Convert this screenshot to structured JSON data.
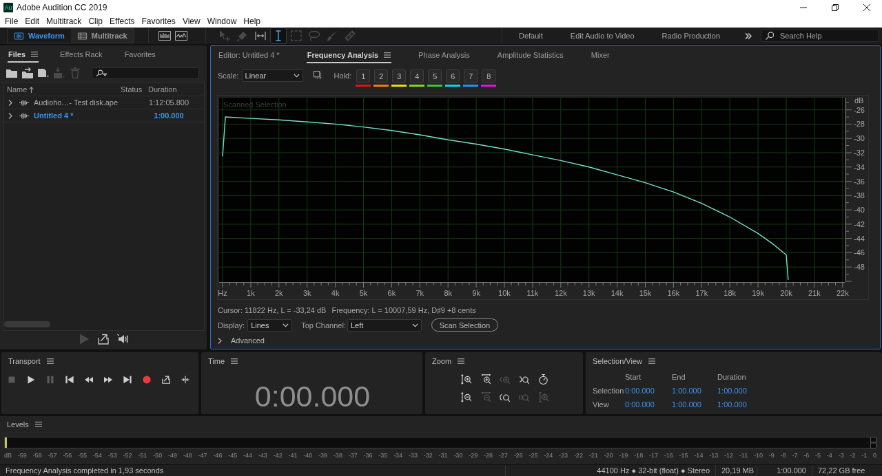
{
  "window": {
    "app_icon": "Au",
    "title": "Adobe Audition CC 2019"
  },
  "menu": [
    "File",
    "Edit",
    "Multitrack",
    "Clip",
    "Effects",
    "Favorites",
    "View",
    "Window",
    "Help"
  ],
  "toolbar": {
    "modes": [
      {
        "label": "Waveform",
        "kind": "waveform",
        "selected": true
      },
      {
        "label": "Multitrack",
        "kind": "multitrack",
        "selected": false
      }
    ],
    "tools": [
      {
        "kind": "move",
        "selected": false,
        "disabled": true
      },
      {
        "kind": "razor",
        "selected": false,
        "disabled": true
      },
      {
        "kind": "slip",
        "selected": false,
        "disabled": false
      },
      {
        "kind": "time",
        "selected": true,
        "disabled": false
      },
      {
        "kind": "marquee",
        "selected": false,
        "disabled": true
      },
      {
        "kind": "lasso",
        "selected": false,
        "disabled": true
      },
      {
        "kind": "brush",
        "selected": false,
        "disabled": true
      },
      {
        "kind": "heal",
        "selected": false,
        "disabled": true
      }
    ],
    "workspaces": [
      "Default",
      "Edit Audio to Video",
      "Radio Production"
    ],
    "search": {
      "placeholder": "Search Help"
    }
  },
  "files_panel": {
    "tabs": [
      {
        "label": "Files",
        "selected": true
      },
      {
        "label": "Effects Rack",
        "selected": false
      },
      {
        "label": "Favorites",
        "selected": false
      }
    ],
    "tools": [
      {
        "kind": "open",
        "disabled": false
      },
      {
        "kind": "import",
        "disabled": false
      },
      {
        "kind": "new",
        "disabled": false
      },
      {
        "kind": "insert",
        "disabled": true
      },
      {
        "kind": "delete",
        "disabled": true
      }
    ],
    "columns": [
      "Name",
      "Status",
      "Duration"
    ],
    "rows": [
      {
        "name": "Audioho…- Test disk.ape",
        "duration": "1:12:05.800",
        "selected": false,
        "expanded": false
      },
      {
        "name": "Untitled 4 *",
        "duration": "1:00.000",
        "selected": true,
        "expanded": false
      }
    ],
    "footer_tools": [
      {
        "kind": "play",
        "disabled": true
      },
      {
        "kind": "export",
        "disabled": false
      },
      {
        "kind": "autoplay",
        "disabled": false
      }
    ]
  },
  "editor": {
    "tabs": [
      {
        "label": "Editor: Untitled 4 *",
        "selected": false
      },
      {
        "label": "Frequency Analysis",
        "selected": true
      },
      {
        "label": "Phase Analysis",
        "selected": false
      },
      {
        "label": "Amplitude Statistics",
        "selected": false
      },
      {
        "label": "Mixer",
        "selected": false
      }
    ],
    "scale": {
      "label": "Scale:",
      "value": "Linear"
    },
    "hold": {
      "label": "Hold:",
      "buttons": [
        {
          "label": "1",
          "color": "#e01414"
        },
        {
          "label": "2",
          "color": "#f07c14"
        },
        {
          "label": "3",
          "color": "#e8e014"
        },
        {
          "label": "4",
          "color": "#84d824"
        },
        {
          "label": "5",
          "color": "#38c838"
        },
        {
          "label": "6",
          "color": "#14d0e8"
        },
        {
          "label": "7",
          "color": "#2c90e8"
        },
        {
          "label": "8",
          "color": "#e014e0"
        }
      ]
    },
    "plot_caption": "Scanned Selection",
    "chart_data": {
      "type": "line",
      "grid": true,
      "xlabel": "Hz",
      "ylabel": "dB",
      "x": [
        0,
        100,
        1000,
        2000,
        3000,
        4000,
        5000,
        6000,
        7000,
        8000,
        9000,
        10000,
        11000,
        12000,
        13000,
        14000,
        15000,
        16000,
        17000,
        18000,
        19000,
        19500,
        20000,
        20070
      ],
      "series": [
        {
          "color": "#72e2c6",
          "values": [
            -32.5,
            -27.0,
            -27.2,
            -27.4,
            -27.7,
            -28.0,
            -28.4,
            -28.9,
            -29.5,
            -30.2,
            -30.8,
            -31.5,
            -32.3,
            -33.1,
            -34.0,
            -35.1,
            -36.2,
            -37.5,
            -39.1,
            -41.0,
            -43.3,
            -44.7,
            -46.3,
            -49.8
          ]
        }
      ],
      "xlim": [
        -122,
        22078
      ],
      "ylim": [
        -50.1,
        -24.3
      ],
      "xticks": [
        {
          "value": 1000,
          "label": "1k"
        },
        {
          "value": 2000,
          "label": "2k"
        },
        {
          "value": 3000,
          "label": "3k"
        },
        {
          "value": 4000,
          "label": "4k"
        },
        {
          "value": 5000,
          "label": "5k"
        },
        {
          "value": 6000,
          "label": "6k"
        },
        {
          "value": 7000,
          "label": "7k"
        },
        {
          "value": 8000,
          "label": "8k"
        },
        {
          "value": 9000,
          "label": "9k"
        },
        {
          "value": 10000,
          "label": "10k"
        },
        {
          "value": 11000,
          "label": "11k"
        },
        {
          "value": 12000,
          "label": "12k"
        },
        {
          "value": 13000,
          "label": "13k"
        },
        {
          "value": 14000,
          "label": "14k"
        },
        {
          "value": 15000,
          "label": "15k"
        },
        {
          "value": 16000,
          "label": "16k"
        },
        {
          "value": 17000,
          "label": "17k"
        },
        {
          "value": 18000,
          "label": "18k"
        },
        {
          "value": 19000,
          "label": "19k"
        },
        {
          "value": 20000,
          "label": "20k"
        },
        {
          "value": 21000,
          "label": "21k"
        },
        {
          "value": 22000,
          "label": "22k"
        }
      ],
      "yticks": [
        -26,
        -28,
        -30,
        -32,
        -34,
        -36,
        -38,
        -40,
        -42,
        -44,
        -46,
        -48
      ]
    },
    "cursor_readout": "Cursor: 11822 Hz, L = -33,24 dB",
    "frequency_readout": "Frequency: L = 10007,59 Hz, D♯9 +8 cents",
    "display": {
      "label": "Display:",
      "value": "Lines"
    },
    "top_channel": {
      "label": "Top Channel:",
      "value": "Left"
    },
    "scan_button": "Scan Selection",
    "advanced": {
      "label": "Advanced",
      "expanded": false
    }
  },
  "transport": {
    "title": "Transport",
    "buttons": [
      {
        "kind": "stop",
        "disabled": true
      },
      {
        "kind": "play",
        "disabled": false
      },
      {
        "kind": "pause",
        "disabled": true
      },
      {
        "kind": "start",
        "disabled": false
      },
      {
        "kind": "rewind",
        "disabled": false
      },
      {
        "kind": "forward",
        "disabled": false
      },
      {
        "kind": "end",
        "disabled": false
      },
      {
        "kind": "record",
        "disabled": false
      },
      {
        "kind": "loop",
        "disabled": false
      },
      {
        "kind": "skip",
        "disabled": false
      }
    ]
  },
  "time": {
    "title": "Time",
    "value": "0:00.000"
  },
  "zoom": {
    "title": "Zoom",
    "buttons": [
      {
        "kind": "ampin",
        "disabled": false
      },
      {
        "kind": "timein",
        "disabled": false
      },
      {
        "kind": "selection",
        "disabled": true
      },
      {
        "kind": "outpoint",
        "disabled": false
      },
      {
        "kind": "full",
        "disabled": false
      },
      {
        "kind": "ampout",
        "disabled": false
      },
      {
        "kind": "timeout",
        "disabled": true
      },
      {
        "kind": "inpoint",
        "disabled": false
      },
      {
        "kind": "between",
        "disabled": true
      },
      {
        "kind": "tracks",
        "disabled": true
      }
    ]
  },
  "selection_view": {
    "title": "Selection/View",
    "columns": [
      "Start",
      "End",
      "Duration"
    ],
    "rows": [
      {
        "label": "Selection",
        "values": [
          "0:00.000",
          "1:00.000",
          "1:00.000"
        ]
      },
      {
        "label": "View",
        "values": [
          "0:00.000",
          "1:00.000",
          "1:00.000"
        ]
      }
    ]
  },
  "levels": {
    "title": "Levels",
    "level": 0.002,
    "scale": [
      "dB",
      "-59",
      "-58",
      "-57",
      "-56",
      "-55",
      "-54",
      "-53",
      "-52",
      "-51",
      "-50",
      "-49",
      "-48",
      "-47",
      "-46",
      "-45",
      "-44",
      "-43",
      "-42",
      "-41",
      "-40",
      "-39",
      "-38",
      "-37",
      "-36",
      "-35",
      "-34",
      "-33",
      "-32",
      "-31",
      "-30",
      "-29",
      "-28",
      "-27",
      "-26",
      "-25",
      "-24",
      "-23",
      "-22",
      "-21",
      "-20",
      "-19",
      "-18",
      "-17",
      "-16",
      "-15",
      "-14",
      "-13",
      "-12",
      "-11",
      "-10",
      "-9",
      "-8",
      "-7",
      "-6",
      "-5",
      "-4",
      "-3",
      "-2",
      "-1",
      "0"
    ]
  },
  "status_bar": {
    "message": "Frequency Analysis completed in 1,93 seconds",
    "items": [
      "44100 Hz ● 32-bit (float) ● Stereo",
      "20,19 MB",
      "1:00.000",
      "72,22 GB free"
    ]
  }
}
